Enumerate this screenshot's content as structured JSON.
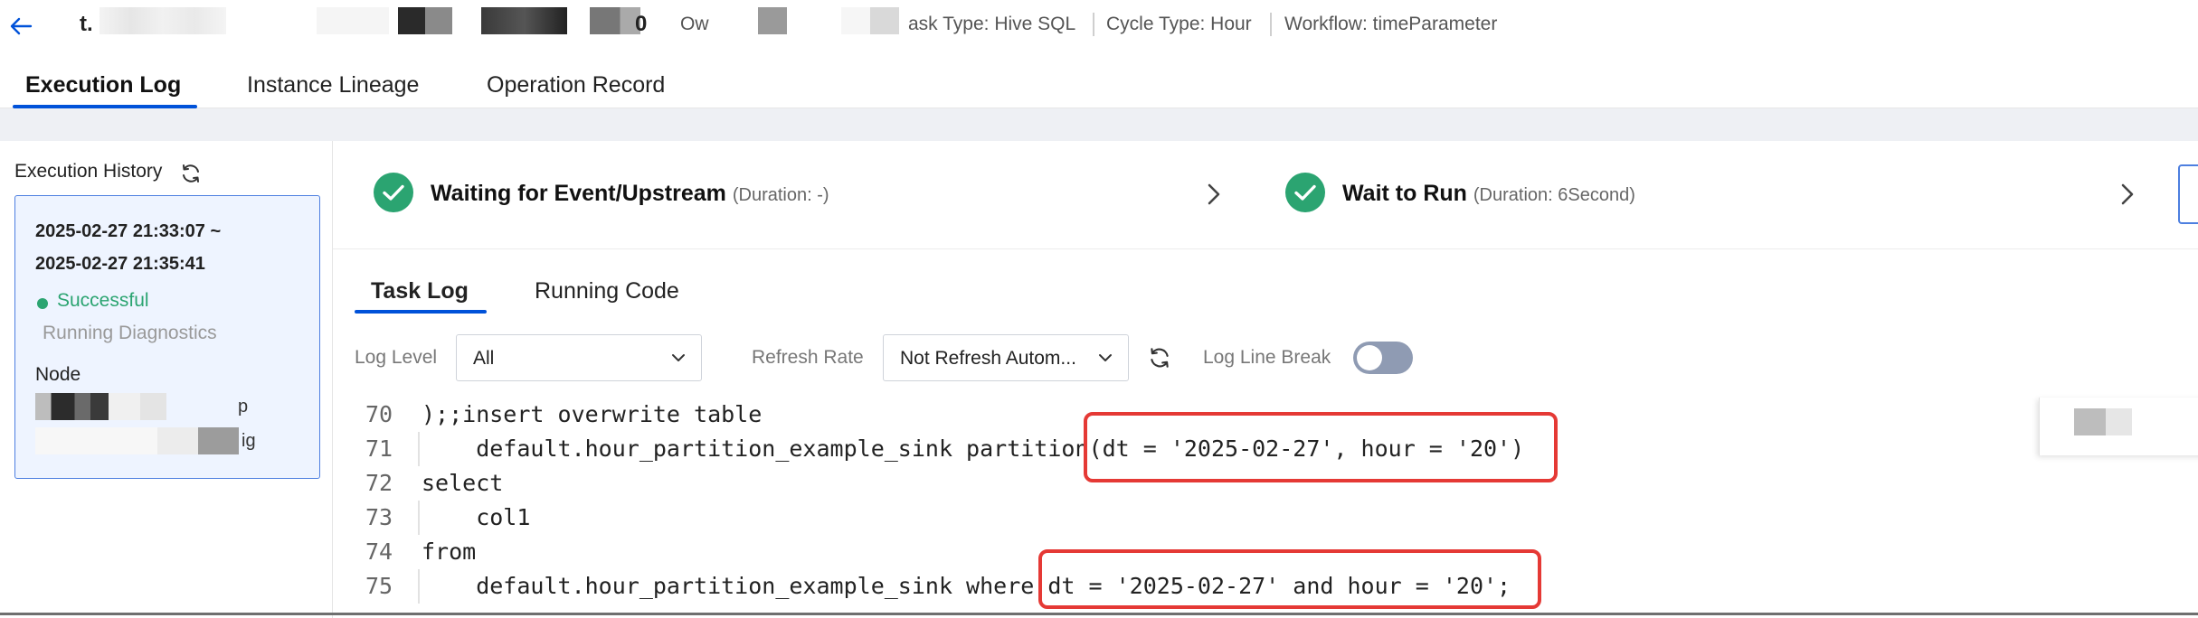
{
  "header": {
    "title_start": "t.",
    "title_end": "0",
    "owner_fragment": "Ow",
    "task_type_fragment": "ask Type: Hive SQL",
    "cycle_type": "Cycle Type: Hour",
    "workflow": "Workflow: timeParameter"
  },
  "main_tabs": [
    {
      "label": "Execution Log",
      "active": true
    },
    {
      "label": "Instance Lineage",
      "active": false
    },
    {
      "label": "Operation Record",
      "active": false
    }
  ],
  "history": {
    "title": "Execution History",
    "item": {
      "time_start": "2025-02-27 21:33:07 ~",
      "time_end": "2025-02-27 21:35:41",
      "status": "Successful",
      "diagnostics": "Running Diagnostics",
      "node_label": "Node",
      "node_fragment_1": "p",
      "node_fragment_2": "ig"
    }
  },
  "steps": [
    {
      "label": "Waiting for Event/Upstream",
      "duration": "(Duration: -)"
    },
    {
      "label": "Wait to Run",
      "duration": "(Duration: 6Second)"
    }
  ],
  "log_tabs": [
    {
      "label": "Task Log",
      "active": true
    },
    {
      "label": "Running Code",
      "active": false
    }
  ],
  "toolbar": {
    "log_level_label": "Log Level",
    "log_level_value": "All",
    "refresh_rate_label": "Refresh Rate",
    "refresh_rate_value": "Not Refresh Autom...",
    "line_break_label": "Log Line Break",
    "line_break_on": false
  },
  "code_lines": [
    {
      "num": "70",
      "text": ");;insert overwrite table"
    },
    {
      "num": "71",
      "text": "    default.hour_partition_example_sink partition(dt = '2025-02-27', hour = '20')"
    },
    {
      "num": "72",
      "text": "select"
    },
    {
      "num": "73",
      "text": "    col1"
    },
    {
      "num": "74",
      "text": "from"
    },
    {
      "num": "75",
      "text": "    default.hour_partition_example_sink where dt = '2025-02-27' and hour = '20';"
    }
  ],
  "colors": {
    "accent": "#0052d9",
    "success": "#2ba471",
    "highlight": "#e53935",
    "card_bg": "#eef4ff"
  }
}
